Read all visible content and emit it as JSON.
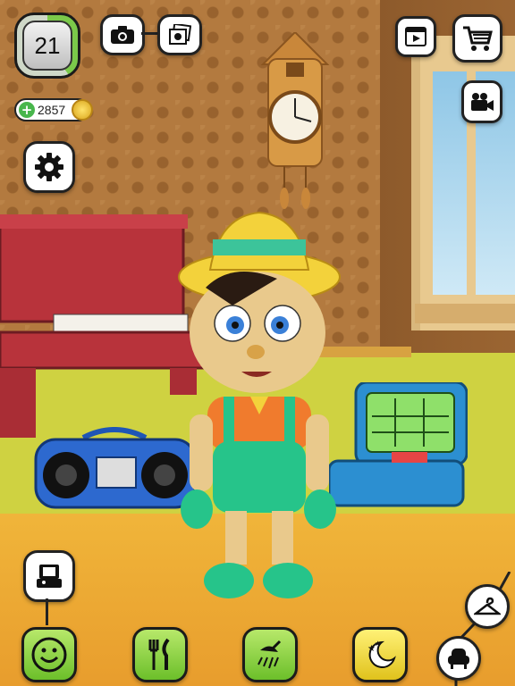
{
  "hud": {
    "level": "21",
    "level_progress": 0.4,
    "coins": "2857"
  },
  "icons": {
    "top_left": [
      "camera-icon",
      "photo-gallery-icon"
    ],
    "top_right": [
      "video-play-icon",
      "shopping-cart-icon",
      "video-camera-icon"
    ],
    "left": [
      "settings-gear-icon",
      "arcade-icon"
    ],
    "bottom": [
      "smiley-face-icon",
      "fork-knife-icon",
      "shower-icon",
      "moon-stars-icon",
      "armchair-icon",
      "hanger-icon"
    ]
  },
  "colors": {
    "accent_green": "#7bc94a",
    "button_green": "#6cbf2a",
    "floor": "#e89d2d"
  }
}
